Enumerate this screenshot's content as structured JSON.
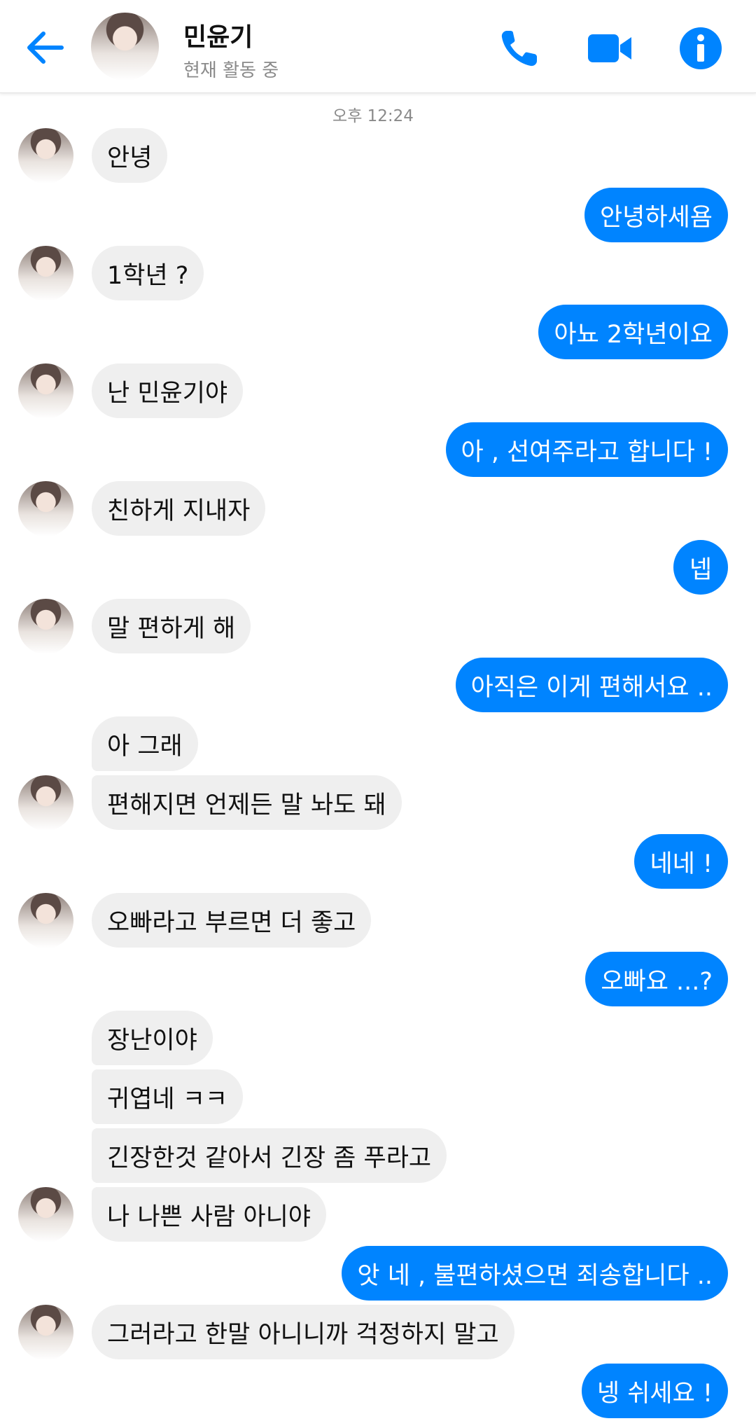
{
  "header": {
    "contact_name": "민윤기",
    "status": "현재 활동 중",
    "icons": {
      "back": "back-arrow-icon",
      "call": "phone-icon",
      "video": "video-camera-icon",
      "info": "info-icon"
    },
    "accent_color": "#0084ff"
  },
  "timestamp": "오후 12:24",
  "messages": [
    {
      "from": "them",
      "text": "안녕"
    },
    {
      "from": "me",
      "text": "안녕하세욤"
    },
    {
      "from": "them",
      "text": "1학년 ?"
    },
    {
      "from": "me",
      "text": "아뇨 2학년이요"
    },
    {
      "from": "them",
      "text": "난 민윤기야"
    },
    {
      "from": "me",
      "text": "아 , 선여주라고 합니다 !"
    },
    {
      "from": "them",
      "text": "친하게 지내자"
    },
    {
      "from": "me",
      "text": "넵"
    },
    {
      "from": "them",
      "text": "말 편하게 해"
    },
    {
      "from": "me",
      "text": "아직은 이게 편해서요 .."
    },
    {
      "from": "them",
      "text": "아 그래"
    },
    {
      "from": "them",
      "text": "편해지면 언제든 말 놔도 돼"
    },
    {
      "from": "me",
      "text": "네네 !"
    },
    {
      "from": "them",
      "text": "오빠라고 부르면 더 좋고"
    },
    {
      "from": "me",
      "text": "오빠요 ...?"
    },
    {
      "from": "them",
      "text": "장난이야"
    },
    {
      "from": "them",
      "text": "귀엽네 ㅋㅋ"
    },
    {
      "from": "them",
      "text": "긴장한것 같아서 긴장 좀 푸라고"
    },
    {
      "from": "them",
      "text": "나 나쁜 사람 아니야"
    },
    {
      "from": "me",
      "text": "앗 네 , 불편하셨으면 죄송합니다 .."
    },
    {
      "from": "them",
      "text": "그러라고 한말 아니니까 걱정하지 말고"
    },
    {
      "from": "me",
      "text": "넹 쉬세요 !"
    }
  ]
}
